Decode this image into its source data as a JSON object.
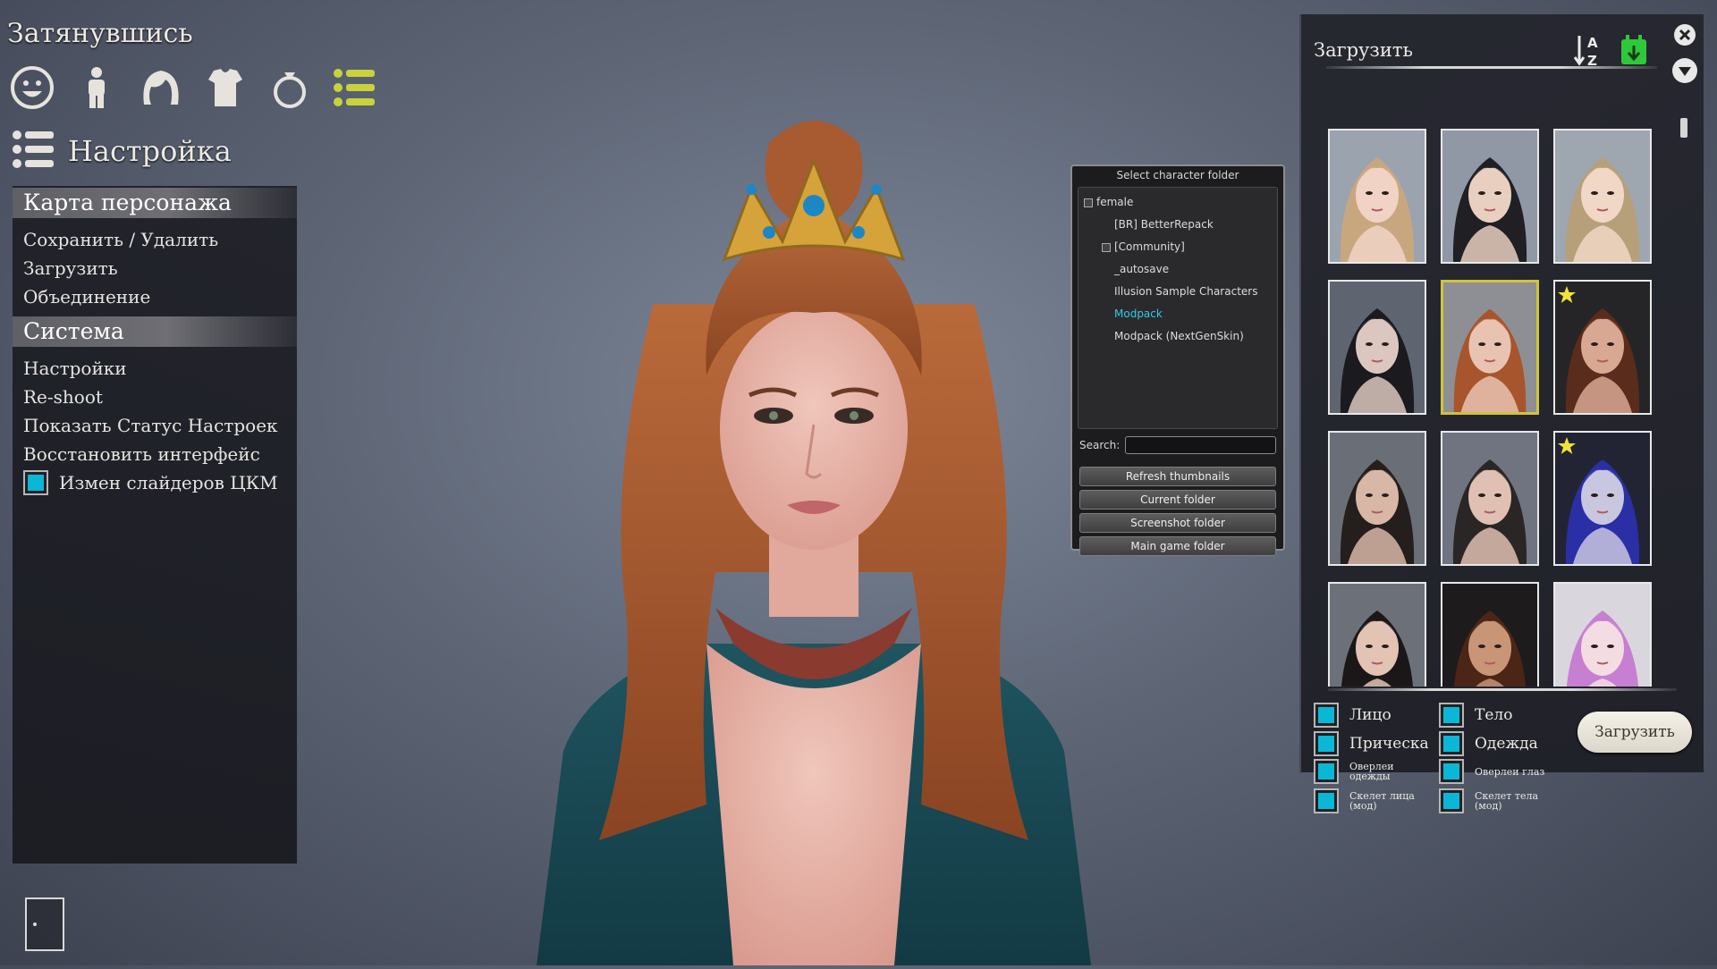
{
  "header": {
    "game_title": "Затянувшись",
    "section_title": "Настройка",
    "category_icons": [
      "face-icon",
      "body-icon",
      "hair-icon",
      "clothes-icon",
      "accessory-icon",
      "extras-icon"
    ]
  },
  "left_menu": {
    "groups": [
      {
        "title": "Карта персонажа",
        "items": [
          "Сохранить / Удалить",
          "Загрузить",
          "Объединение"
        ]
      },
      {
        "title": "Система",
        "items": [
          "Настройки",
          "Re-shoot",
          "Показать Статус Настроек",
          "Восстановить интерфейс"
        ]
      }
    ],
    "checkbox_item": {
      "label": "Измен слайдеров ЦКМ",
      "checked": true
    }
  },
  "folder_panel": {
    "title": "Select character folder",
    "tree": [
      {
        "label": "female",
        "level": 0,
        "toggle": true
      },
      {
        "label": "[BR] BetterRepack",
        "level": 1,
        "toggle": false
      },
      {
        "label": "[Community]",
        "level": 1,
        "toggle": true
      },
      {
        "label": "_autosave",
        "level": 1,
        "toggle": false
      },
      {
        "label": "Illusion Sample Characters",
        "level": 1,
        "toggle": false
      },
      {
        "label": "Modpack",
        "level": 1,
        "toggle": false,
        "selected": true
      },
      {
        "label": "Modpack (NextGenSkin)",
        "level": 1,
        "toggle": false
      }
    ],
    "search_label": "Search:",
    "search_value": "",
    "buttons": [
      "Refresh thumbnails",
      "Current folder",
      "Screenshot folder",
      "Main game folder"
    ]
  },
  "load_panel": {
    "title": "Загрузить",
    "load_button": "Загрузить",
    "thumbnails": [
      {
        "hair": "#c9a77e",
        "skin": "#f0d3c4",
        "bg": "#9aa3ae",
        "fav": false,
        "selected": false
      },
      {
        "hair": "#1f1f24",
        "skin": "#e9cfc0",
        "bg": "#8f98a4",
        "fav": false,
        "selected": false
      },
      {
        "hair": "#b6a079",
        "skin": "#f0d7c6",
        "bg": "#9ea6b0",
        "fav": false,
        "selected": false
      },
      {
        "hair": "#1a1a1f",
        "skin": "#dcc7c0",
        "bg": "#5f6570",
        "fav": false,
        "selected": false
      },
      {
        "hair": "#a7552c",
        "skin": "#e8c3b1",
        "bg": "#8e8f95",
        "fav": false,
        "selected": true
      },
      {
        "hair": "#5a2c1c",
        "skin": "#d9a893",
        "bg": "#252527",
        "fav": true,
        "selected": false
      },
      {
        "hair": "#241e1c",
        "skin": "#d8b7a6",
        "bg": "#6a6e76",
        "fav": false,
        "selected": false
      },
      {
        "hair": "#2a2626",
        "skin": "#dfc0b2",
        "bg": "#6f7480",
        "fav": false,
        "selected": false
      },
      {
        "hair": "#2a2fa6",
        "skin": "#c9c6df",
        "bg": "#222433",
        "fav": true,
        "selected": false
      },
      {
        "hair": "#1b1718",
        "skin": "#e3c3b4",
        "bg": "#6c7079",
        "fav": false,
        "selected": false
      },
      {
        "hair": "#4b2617",
        "skin": "#c99577",
        "bg": "#1d1b1b",
        "fav": false,
        "selected": false
      },
      {
        "hair": "#c77fd1",
        "skin": "#f4dde2",
        "bg": "#d9d6de",
        "fav": false,
        "selected": false
      }
    ],
    "options": [
      {
        "label": "Лицо",
        "checked": true,
        "small": false
      },
      {
        "label": "Тело",
        "checked": true,
        "small": false
      },
      {
        "label": "Прическа",
        "checked": true,
        "small": false
      },
      {
        "label": "Одежда",
        "checked": true,
        "small": false
      },
      {
        "label": "Оверлеи одежды",
        "checked": true,
        "small": true
      },
      {
        "label": "Оверлеи глаз",
        "checked": true,
        "small": true
      },
      {
        "label": "Скелет лица (мод)",
        "checked": true,
        "small": true
      },
      {
        "label": "Скелет тела (мод)",
        "checked": true,
        "small": true
      }
    ],
    "icons": {
      "sort": "sort-az-icon",
      "save": "calendar-download-icon",
      "close": "close-icon",
      "collapse": "chevron-down-icon"
    }
  },
  "colors": {
    "accent_cyan": "#0bb7d6",
    "selected_border": "#d0c43a",
    "folder_selected": "#33c9e6",
    "save_green": "#2fc83a"
  }
}
